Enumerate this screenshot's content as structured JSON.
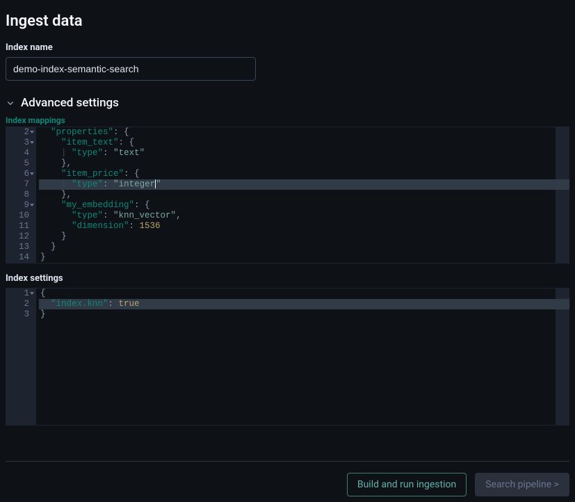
{
  "page": {
    "title": "Ingest data"
  },
  "fields": {
    "indexName": {
      "label": "Index name",
      "value": "demo-index-semantic-search"
    }
  },
  "accordion": {
    "advanced": "Advanced settings"
  },
  "labels": {
    "indexMappings": "Index mappings",
    "indexSettings": "Index settings"
  },
  "editors": {
    "mappings": {
      "highlightLine": 7,
      "lines": [
        {
          "n": 2,
          "fold": true,
          "tokens": [
            [
              "ind",
              "  "
            ],
            [
              "key",
              "\"properties\""
            ],
            [
              "punc",
              ": {"
            ]
          ]
        },
        {
          "n": 3,
          "fold": true,
          "tokens": [
            [
              "ind",
              "    "
            ],
            [
              "key",
              "\"item_text\""
            ],
            [
              "punc",
              ": {"
            ]
          ]
        },
        {
          "n": 4,
          "fold": false,
          "tokens": [
            [
              "ind",
              "    "
            ],
            [
              "guide",
              "| "
            ],
            [
              "key",
              "\"type\""
            ],
            [
              "punc",
              ": "
            ],
            [
              "str",
              "\"text\""
            ]
          ]
        },
        {
          "n": 5,
          "fold": false,
          "tokens": [
            [
              "ind",
              "    "
            ],
            [
              "punc",
              "},"
            ]
          ]
        },
        {
          "n": 6,
          "fold": true,
          "tokens": [
            [
              "ind",
              "    "
            ],
            [
              "key",
              "\"item_price\""
            ],
            [
              "punc",
              ": {"
            ]
          ]
        },
        {
          "n": 7,
          "fold": false,
          "tokens": [
            [
              "ind",
              "    "
            ],
            [
              "guide",
              "| "
            ],
            [
              "key",
              "\"type\""
            ],
            [
              "punc",
              ": "
            ],
            [
              "str-cursor",
              "\"integer\""
            ]
          ]
        },
        {
          "n": 8,
          "fold": false,
          "tokens": [
            [
              "ind",
              "    "
            ],
            [
              "punc",
              "},"
            ]
          ]
        },
        {
          "n": 9,
          "fold": true,
          "tokens": [
            [
              "ind",
              "    "
            ],
            [
              "key",
              "\"my_embedding\""
            ],
            [
              "punc",
              ": {"
            ]
          ]
        },
        {
          "n": 10,
          "fold": false,
          "tokens": [
            [
              "ind",
              "      "
            ],
            [
              "key",
              "\"type\""
            ],
            [
              "punc",
              ": "
            ],
            [
              "str",
              "\"knn_vector\""
            ],
            [
              "punc",
              ","
            ]
          ]
        },
        {
          "n": 11,
          "fold": false,
          "tokens": [
            [
              "ind",
              "      "
            ],
            [
              "key",
              "\"dimension\""
            ],
            [
              "punc",
              ": "
            ],
            [
              "num",
              "1536"
            ]
          ]
        },
        {
          "n": 12,
          "fold": false,
          "tokens": [
            [
              "ind",
              "    "
            ],
            [
              "punc",
              "}"
            ]
          ]
        },
        {
          "n": 13,
          "fold": false,
          "tokens": [
            [
              "ind",
              "  "
            ],
            [
              "punc",
              "}"
            ]
          ]
        },
        {
          "n": 14,
          "fold": false,
          "tokens": [
            [
              "punc",
              "}"
            ]
          ]
        }
      ]
    },
    "settings": {
      "highlightLine": 2,
      "lines": [
        {
          "n": 1,
          "fold": true,
          "tokens": [
            [
              "punc",
              "{"
            ]
          ]
        },
        {
          "n": 2,
          "fold": false,
          "tokens": [
            [
              "ind",
              "  "
            ],
            [
              "key",
              "\"index.knn\""
            ],
            [
              "punc",
              ": "
            ],
            [
              "bool",
              "true"
            ]
          ]
        },
        {
          "n": 3,
          "fold": false,
          "tokens": [
            [
              "punc",
              "}"
            ]
          ]
        }
      ]
    }
  },
  "buttons": {
    "build": "Build and run ingestion",
    "searchPipeline": "Search pipeline >"
  }
}
